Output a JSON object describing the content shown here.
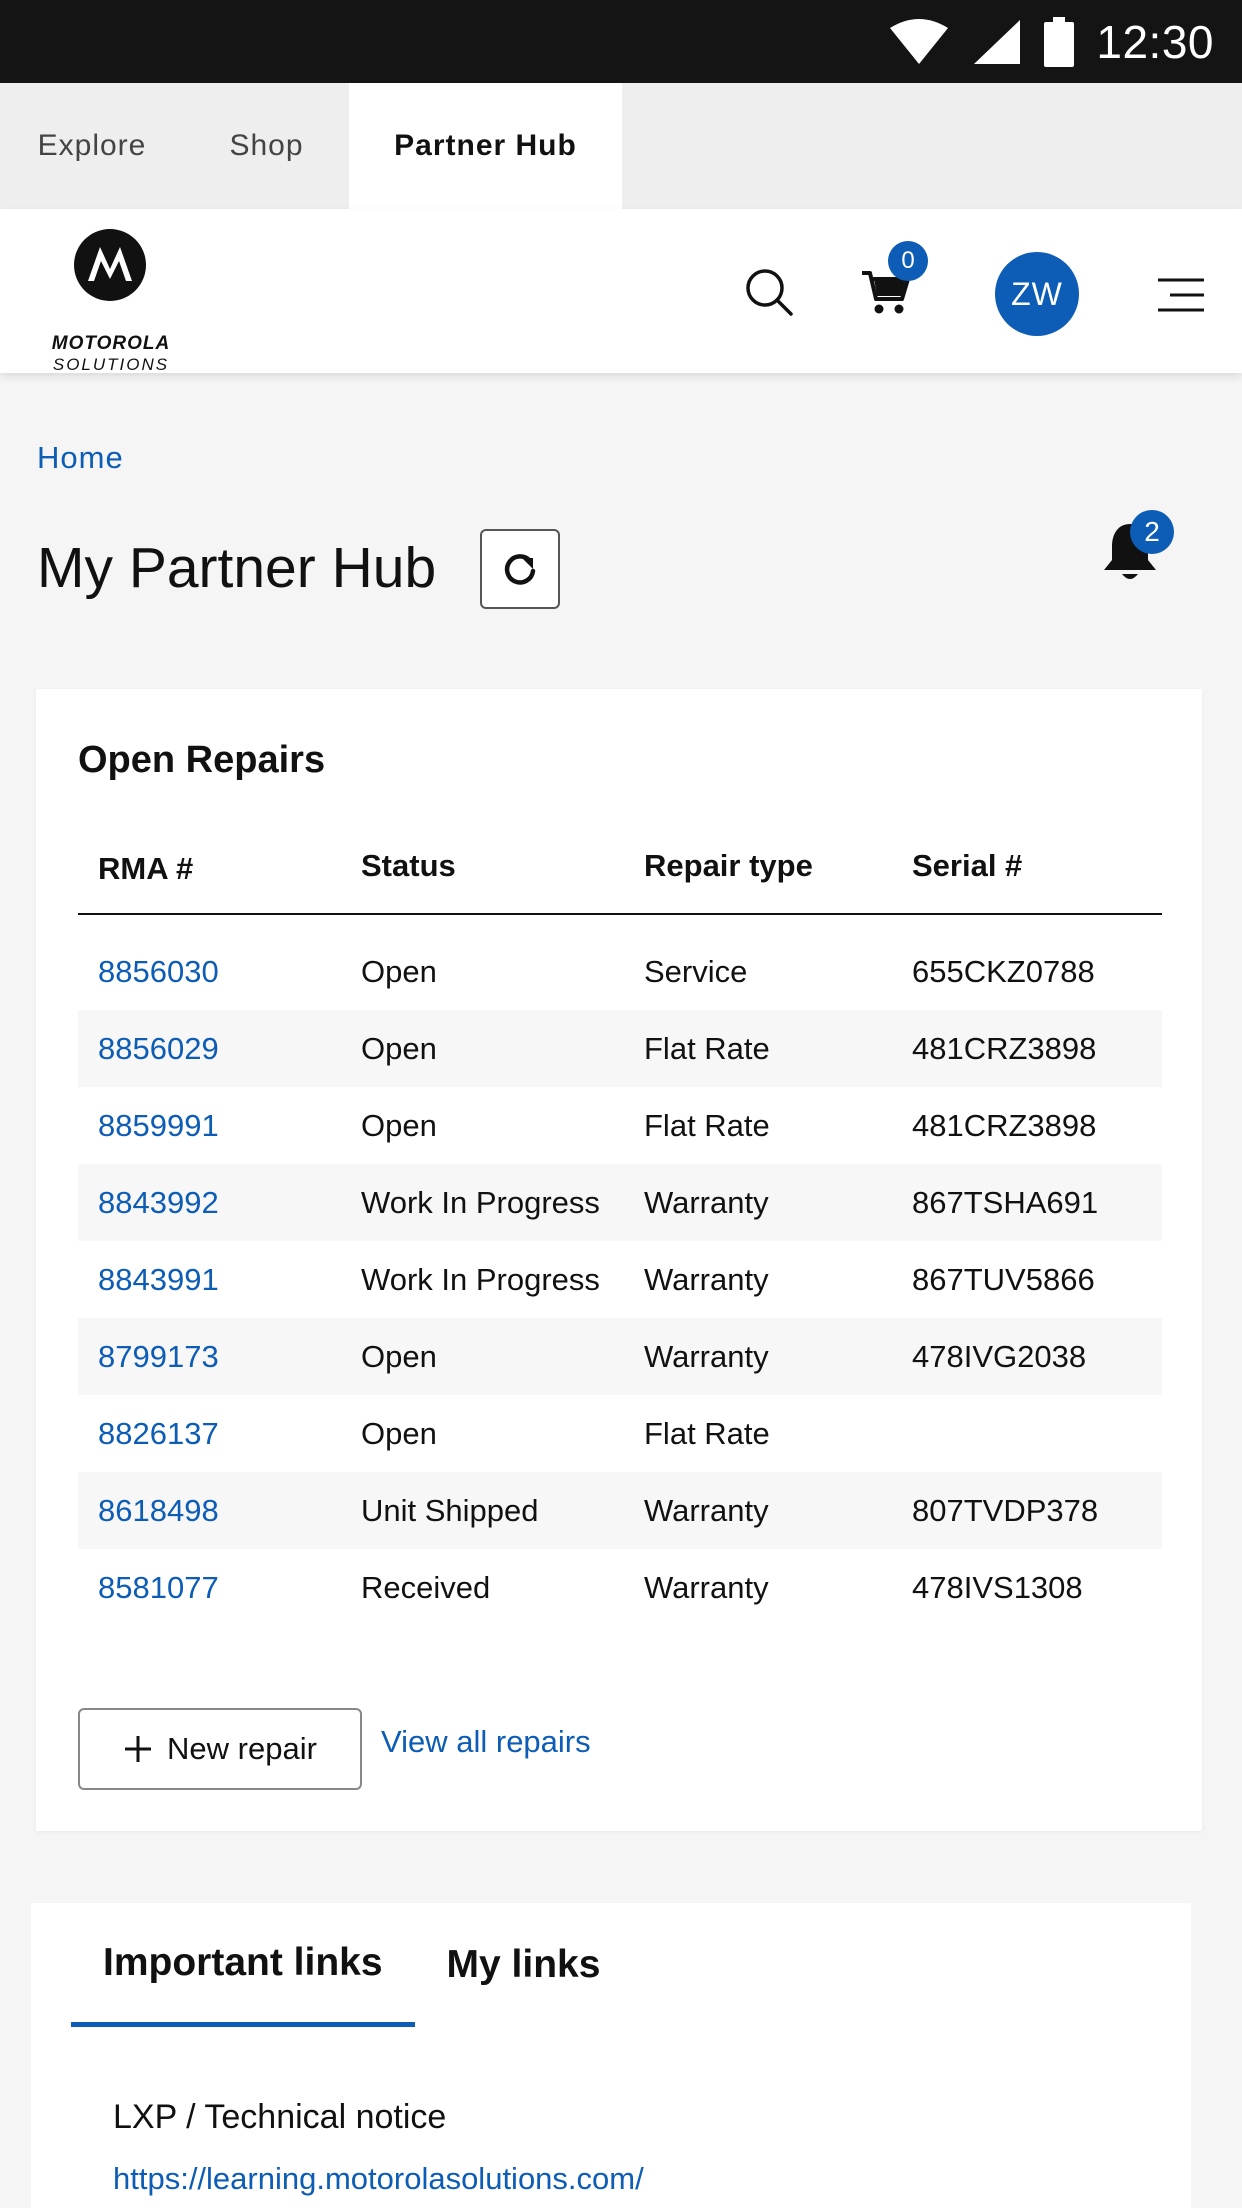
{
  "status_bar": {
    "time": "12:30"
  },
  "top_tabs": [
    "Explore",
    "Shop",
    "Partner Hub"
  ],
  "header": {
    "logo_line1": "MOTOROLA",
    "logo_line2": "SOLUTIONS",
    "cart_count": "0",
    "avatar_initials": "ZW"
  },
  "breadcrumb": "Home",
  "page_title": "My Partner Hub",
  "notifications_count": "2",
  "open_repairs": {
    "title": "Open Repairs",
    "columns": [
      "RMA #",
      "Status",
      "Repair type",
      "Serial #"
    ],
    "rows": [
      [
        "8856030",
        "Open",
        "Service",
        "655CKZ0788"
      ],
      [
        "8856029",
        "Open",
        "Flat Rate",
        "481CRZ3898"
      ],
      [
        "8859991",
        "Open",
        "Flat Rate",
        "481CRZ3898"
      ],
      [
        "8843992",
        "Work In Progress",
        "Warranty",
        "867TSHA691"
      ],
      [
        "8843991",
        "Work In Progress",
        "Warranty",
        "867TUV5866"
      ],
      [
        "8799173",
        "Open",
        "Warranty",
        "478IVG2038"
      ],
      [
        "8826137",
        "Open",
        "Flat Rate",
        ""
      ],
      [
        "8618498",
        "Unit Shipped",
        "Warranty",
        "807TVDP378"
      ],
      [
        "8581077",
        "Received",
        "Warranty",
        "478IVS1308"
      ]
    ],
    "new_repair_label": "New repair",
    "view_all_label": "View all repairs"
  },
  "links": {
    "tabs": [
      "Important links",
      "My links"
    ],
    "item_title": "LXP / Technical notice",
    "item_url": "https://learning.motorolasolutions.com/"
  },
  "colors": {
    "accent": "#0d5cb6",
    "status_bar": "#141414"
  }
}
